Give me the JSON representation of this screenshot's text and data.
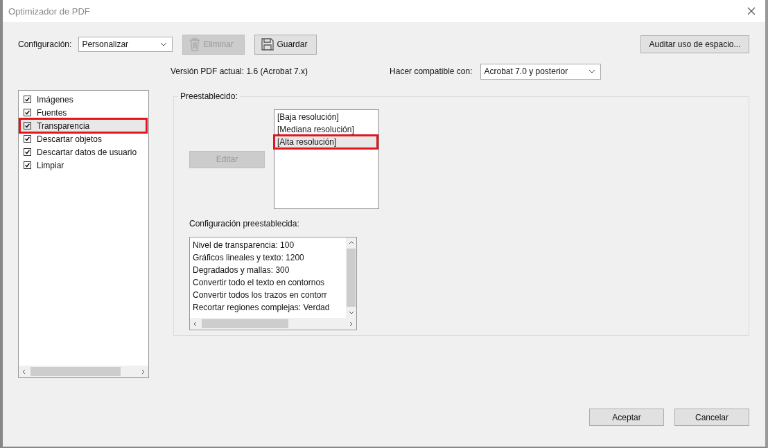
{
  "window": {
    "title": "Optimizador de PDF"
  },
  "toolbar": {
    "settings_label": "Configuración:",
    "settings_value": "Personalizar",
    "delete_button": {
      "label": "Eliminar",
      "disabled": true
    },
    "save_button": {
      "label": "Guardar",
      "disabled": false
    },
    "audit_button": "Auditar uso de espacio..."
  },
  "version": "Versión PDF actual: 1.6 (Acrobat 7.x)",
  "compat_label": "Hacer compatible con:",
  "compat_value": "Acrobat 7.0 y posterior",
  "categories": [
    {
      "label": "Imágenes",
      "checked": true,
      "selected": false,
      "highlighted": false
    },
    {
      "label": "Fuentes",
      "checked": true,
      "selected": false,
      "highlighted": false
    },
    {
      "label": "Transparencia",
      "checked": true,
      "selected": true,
      "highlighted": true
    },
    {
      "label": "Descartar objetos",
      "checked": true,
      "selected": false,
      "highlighted": false
    },
    {
      "label": "Descartar datos de usuario",
      "checked": true,
      "selected": false,
      "highlighted": false
    },
    {
      "label": "Limpiar",
      "checked": true,
      "selected": false,
      "highlighted": false
    }
  ],
  "presets": {
    "legend": "Preestablecido:",
    "edit_button": {
      "label": "Editar",
      "disabled": true
    },
    "items": [
      {
        "label": "[Baja resolución]",
        "selected": false,
        "highlighted": false
      },
      {
        "label": "[Mediana resolución]",
        "selected": false,
        "highlighted": false
      },
      {
        "label": "[Alta resolución]",
        "selected": true,
        "highlighted": true
      }
    ],
    "settings_label": "Configuración preestablecida:",
    "settings": [
      "Nivel de transparencia: 100",
      "Gráficos lineales y texto: 1200",
      "Degradados y mallas: 300",
      "Convertir todo el texto en contornos",
      "Convertir todos los trazos en contorr",
      "Recortar regiones complejas: Verdad"
    ]
  },
  "buttons": [
    "Aceptar",
    "Cancelar"
  ]
}
